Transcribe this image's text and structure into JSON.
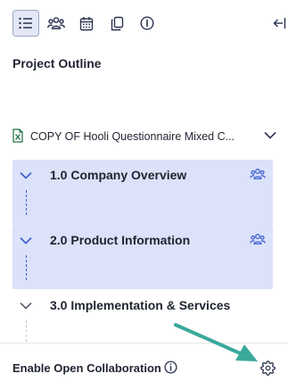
{
  "toolbar": {
    "icons": [
      "list-icon",
      "people-icon",
      "calendar-icon",
      "copy-icon",
      "info-icon",
      "collapse-panel-icon"
    ],
    "active": "list-icon"
  },
  "outline": {
    "title": "Project Outline"
  },
  "document": {
    "name": "COPY OF Hooli Questionnaire Mixed C...",
    "icon": "excel-file-icon"
  },
  "sections": [
    {
      "title": "1.0 Company Overview",
      "highlighted": true,
      "has_people_icon": true
    },
    {
      "title": "2.0 Product Information",
      "highlighted": true,
      "has_people_icon": true
    },
    {
      "title": "3.0 Implementation & Services",
      "highlighted": false,
      "has_people_icon": false
    }
  ],
  "footer": {
    "collab_label": "Enable Open Collaboration"
  },
  "colors": {
    "accent": "#3b5bd0",
    "highlight_bg": "#dbe2f9",
    "active_tab_bg": "#e4e7f6",
    "excel_green": "#1e7145",
    "annotation_arrow": "#3aa99a"
  }
}
